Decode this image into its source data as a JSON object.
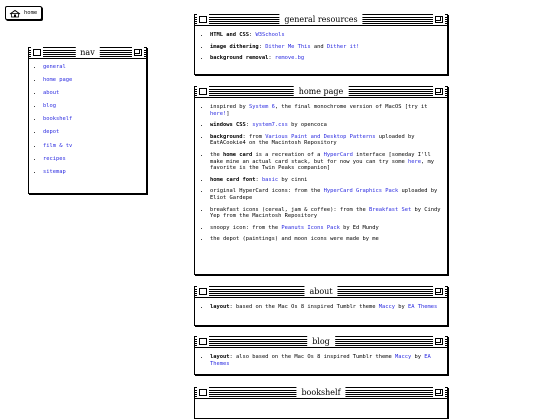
{
  "home_button": {
    "label": "home",
    "icon": "house-icon"
  },
  "nav": {
    "title": "nav",
    "items": [
      "general",
      "home page",
      "about",
      "blog",
      "bookshelf",
      "depot",
      "film & tv",
      "recipes",
      "sitemap"
    ]
  },
  "general": {
    "title": "general resources",
    "items": [
      {
        "label": "HTML and CSS",
        "sep": ": ",
        "links": [
          "W3Schools"
        ]
      },
      {
        "label": "image dithering",
        "sep": ": ",
        "links": [
          "Dither Me This"
        ],
        "mid": " and ",
        "links2": [
          "Dither it!"
        ]
      },
      {
        "label": "background removal",
        "sep": ": ",
        "links": [
          "remove.bg"
        ]
      }
    ]
  },
  "home": {
    "title": "home page",
    "i1": {
      "pre": "inspired by ",
      "link": "System 6",
      "post": ", the final monochrome version of MacOS [try it ",
      "link2": "here!",
      "post2": "]"
    },
    "i2": {
      "label": "windows CSS",
      "sep": ": ",
      "link": "system7.css",
      "post": " by opencoca"
    },
    "i3": {
      "label": "background",
      "sep": ": from ",
      "link": "Various Paint and Desktop Patterns",
      "post": " uploaded by EatACookie4 on the Macintosh Repository"
    },
    "i4": {
      "pre": "the ",
      "label": "home card",
      "mid": " is a recreation of a ",
      "link": "HyperCard",
      "post": " interface [someday I'll make mine an actual card stack, but for now you can try some ",
      "link2": "here",
      "post2": ", my favorite is the Twin Peaks companion]"
    },
    "i5": {
      "label": "home card font",
      "sep": ": ",
      "link": "basic",
      "post": " by cinni"
    },
    "i6": {
      "pre": "original HyperCard icons: from the ",
      "link": "HyperCard Graphics Pack",
      "post": " uploaded by Eliot Gardepe"
    },
    "i7": {
      "pre": "breakfast icons (cereal, jam & coffee): from the ",
      "link": "Breakfast Set",
      "post": " by Cindy Yep from the Macintosh Repository"
    },
    "i8": {
      "pre": "snoopy icon: from the ",
      "link": "Peanuts Icons Pack",
      "post": " by Ed Mundy"
    },
    "i9": {
      "pre": "the depot (paintings) and moon icons were made by me"
    }
  },
  "about": {
    "title": "about",
    "i1": {
      "label": "layout",
      "sep": ": based on the Mac Os 8 inspired Tumblr theme ",
      "link": "Maccy",
      "mid": " by ",
      "link2": "EA Themes"
    }
  },
  "blog": {
    "title": "blog",
    "i1": {
      "label": "layout",
      "sep": ": also based on the Mac Os 8 inspired Tumblr theme ",
      "link": "Maccy",
      "mid": " by ",
      "link2": "EA Themes"
    }
  },
  "bookshelf": {
    "title": "bookshelf"
  }
}
